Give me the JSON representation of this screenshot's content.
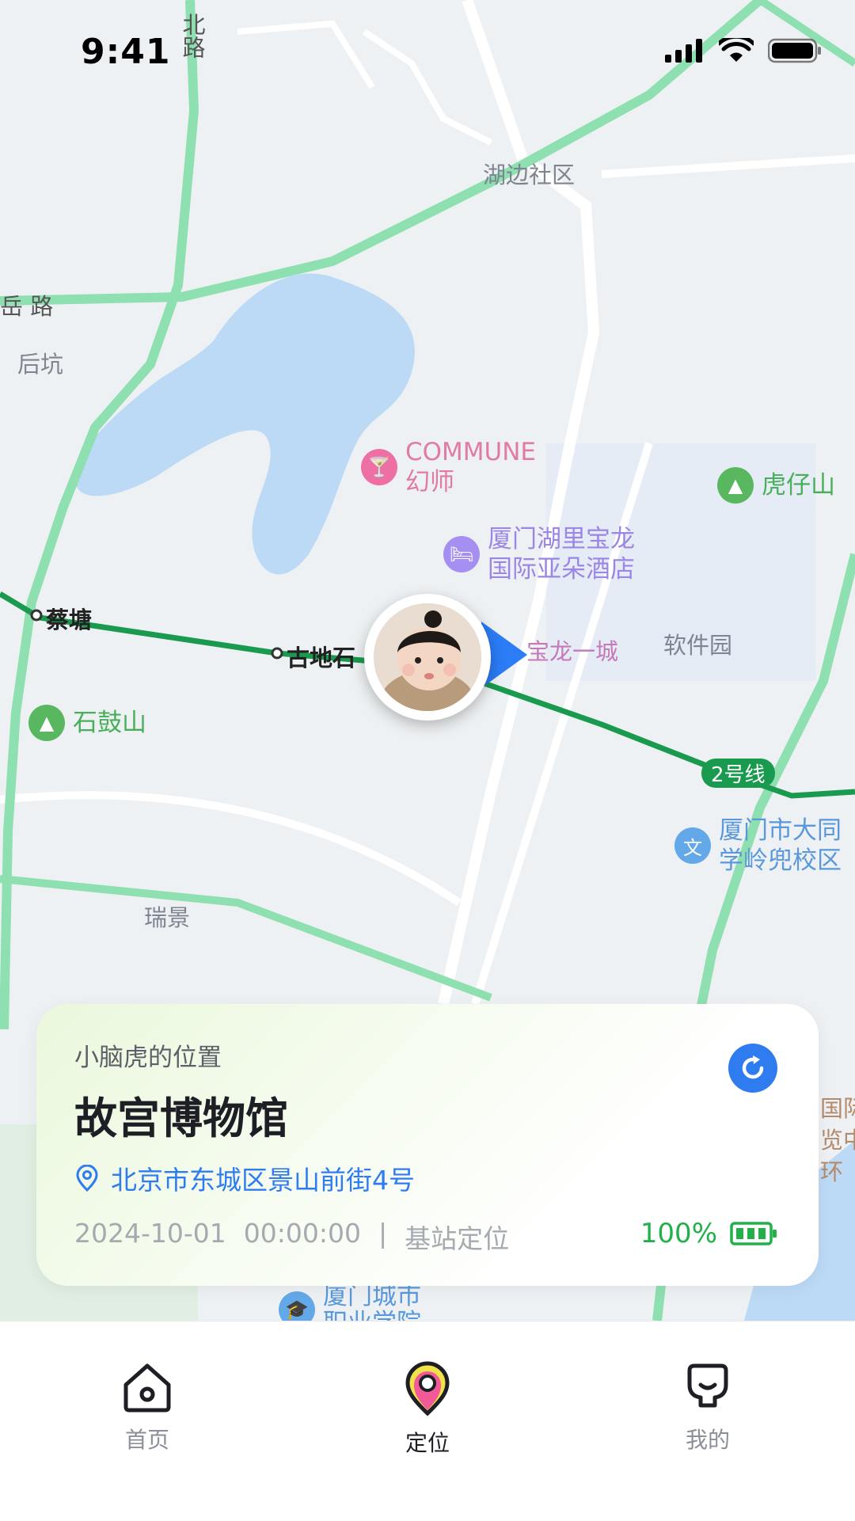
{
  "status_bar": {
    "time": "9:41"
  },
  "map": {
    "labels": {
      "hubian": "湖边社区",
      "houkeng": "后坑",
      "road_top": "北路",
      "road_left": "岳 路",
      "caitang": "蔡塘",
      "gudishi": "古地石",
      "ruijing": "瑞景",
      "ruanjianyuan": "软件园",
      "baolong": "宝龙一城",
      "line2": "2号线"
    },
    "pois": {
      "commune": "COMMUNE\n幻师",
      "hotel": "厦门湖里宝龙\n国际亚朵酒店",
      "huzaishan": "虎仔山",
      "shigushan": "石鼓山",
      "school": "厦门市大同\n学岭兜校区",
      "college": "厦门城市\n职业学院",
      "right_edge": "国际\n览中\n环"
    }
  },
  "card": {
    "subtitle": "小脑虎的位置",
    "title": "故宫博物馆",
    "address": "北京市东城区景山前街4号",
    "date": "2024-10-01",
    "time": "00:00:00",
    "separator": "|",
    "method": "基站定位",
    "battery": "100%"
  },
  "tabs": [
    {
      "label": "首页",
      "icon": "home-icon"
    },
    {
      "label": "定位",
      "icon": "location-pin-icon"
    },
    {
      "label": "我的",
      "icon": "profile-icon"
    }
  ],
  "colors": {
    "accent": "#2f7cf0",
    "battery": "#22b04a",
    "road": "#8ee0b0",
    "metro": "#1a9a4e",
    "water": "#bcd9f5"
  }
}
